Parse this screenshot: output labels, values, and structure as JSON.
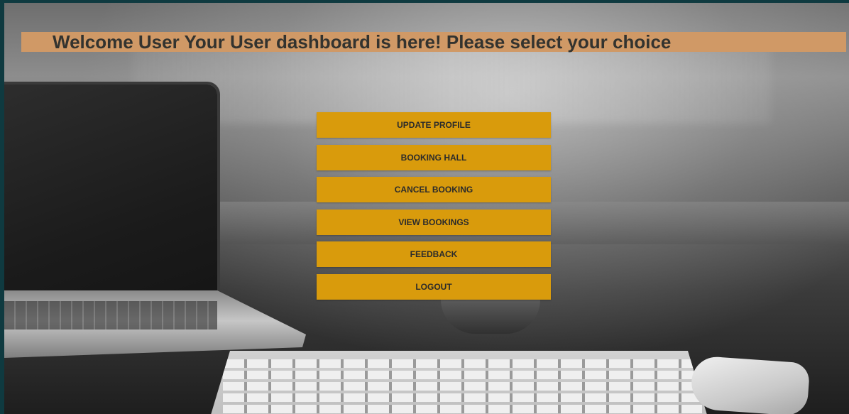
{
  "header": {
    "welcome_text": "Welcome User Your User dashboard is here! Please select your choice"
  },
  "menu": {
    "items": [
      {
        "label": "UPDATE PROFILE"
      },
      {
        "label": "BOOKING HALL"
      },
      {
        "label": "CANCEL BOOKING"
      },
      {
        "label": "VIEW BOOKINGS"
      },
      {
        "label": "FEEDBACK"
      },
      {
        "label": "LOGOUT"
      }
    ]
  },
  "colors": {
    "banner_background": "#d09966",
    "button_background": "#d99b0c",
    "button_text": "#2b2b2b",
    "frame_border": "#0f3a40"
  }
}
